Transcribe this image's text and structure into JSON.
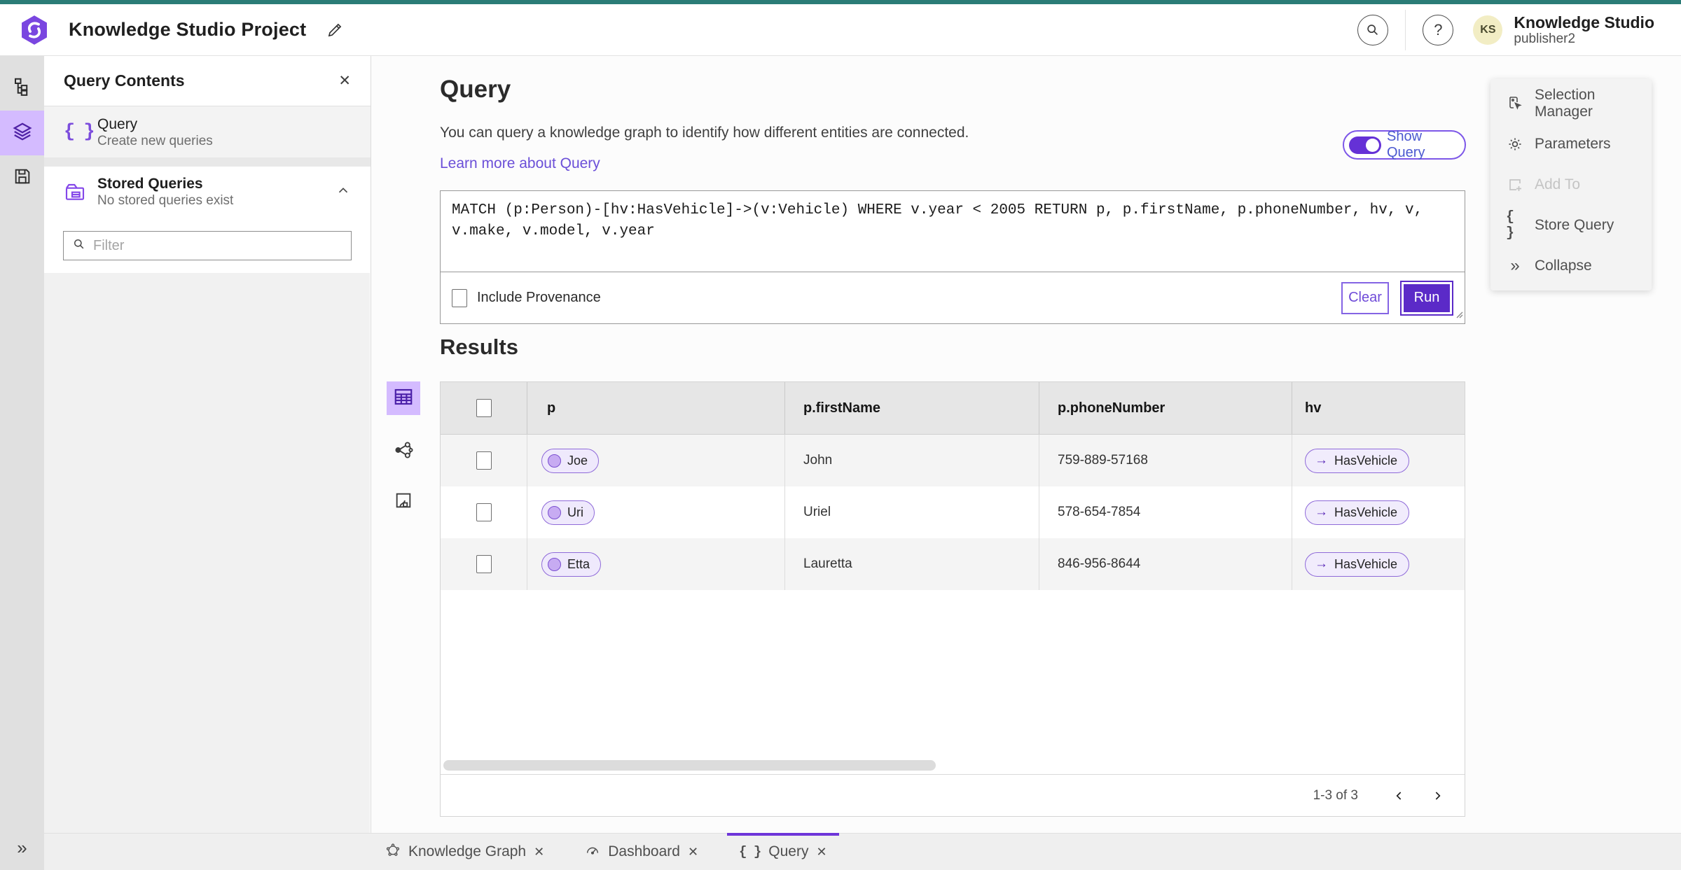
{
  "header": {
    "title": "Knowledge Studio Project",
    "user": {
      "initials": "KS",
      "name": "Knowledge Studio",
      "role": "publisher2"
    }
  },
  "icons": {
    "braces": "{ }",
    "close": "✕",
    "help": "?",
    "arrow_right": "→",
    "collapse_double": "»"
  },
  "left_panel": {
    "title": "Query Contents",
    "query_item": {
      "title": "Query",
      "subtitle": "Create new queries"
    },
    "stored_item": {
      "title": "Stored Queries",
      "subtitle": "No stored queries exist"
    },
    "filter_placeholder": "Filter"
  },
  "query": {
    "heading": "Query",
    "description": "You can query a knowledge graph to identify how different entities are connected.",
    "learn_more": "Learn more about Query",
    "show_query": "Show Query",
    "text": "MATCH (p:Person)-[hv:HasVehicle]->(v:Vehicle) WHERE v.year < 2005 RETURN p, p.firstName, p.phoneNumber, hv, v, v.make, v.model, v.year",
    "include_provenance": "Include Provenance",
    "clear": "Clear",
    "run": "Run"
  },
  "results": {
    "heading": "Results",
    "columns": [
      "p",
      "p.firstName",
      "p.phoneNumber",
      "hv"
    ],
    "rows": [
      {
        "p": "Joe",
        "firstName": "John",
        "phoneNumber": "759-889-57168",
        "hv": "HasVehicle"
      },
      {
        "p": "Uri",
        "firstName": "Uriel",
        "phoneNumber": "578-654-7854",
        "hv": "HasVehicle"
      },
      {
        "p": "Etta",
        "firstName": "Lauretta",
        "phoneNumber": "846-956-8644",
        "hv": "HasVehicle"
      }
    ],
    "pagination": "1-3 of 3"
  },
  "right_menu": {
    "items": [
      "Selection Manager",
      "Parameters",
      "Add To",
      "Store Query",
      "Collapse"
    ]
  },
  "bottom_tabs": [
    {
      "label": "Knowledge Graph"
    },
    {
      "label": "Dashboard"
    },
    {
      "label": "Query"
    }
  ],
  "colors": {
    "topbar": "#2b7c77",
    "accent": "#6532d6",
    "rail_active": "#d4bbff"
  }
}
